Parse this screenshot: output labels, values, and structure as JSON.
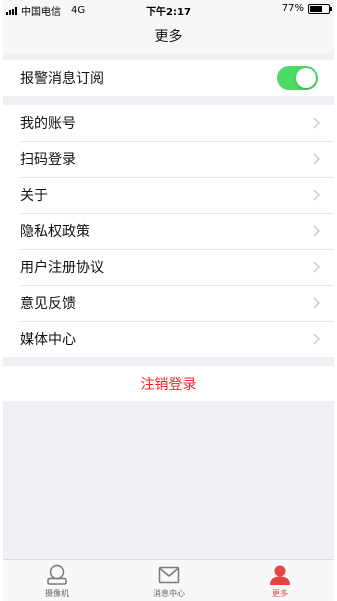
{
  "status_bar": {
    "carrier": "中国电信",
    "network": "4G",
    "time": "下午2:17",
    "battery": "77%",
    "battery_level": 0.77
  },
  "nav": {
    "title": "更多"
  },
  "alarm_row": {
    "label": "报警消息订阅",
    "enabled": true
  },
  "menu": {
    "items": [
      {
        "label": "我的账号"
      },
      {
        "label": "扫码登录"
      },
      {
        "label": "关于"
      },
      {
        "label": "隐私权政策"
      },
      {
        "label": "用户注册协议"
      },
      {
        "label": "意见反馈"
      },
      {
        "label": "媒体中心"
      }
    ]
  },
  "logout": {
    "label": "注销登录"
  },
  "tabbar": {
    "tabs": [
      {
        "label": "摄像机",
        "icon": "camera-icon"
      },
      {
        "label": "消息中心",
        "icon": "mail-icon"
      },
      {
        "label": "更多",
        "icon": "person-icon",
        "active": true
      }
    ]
  },
  "colors": {
    "accent_red": "#e64545",
    "logout_red": "#ff1f1f",
    "toggle_green": "#4cd964",
    "background": "#efeff4"
  }
}
